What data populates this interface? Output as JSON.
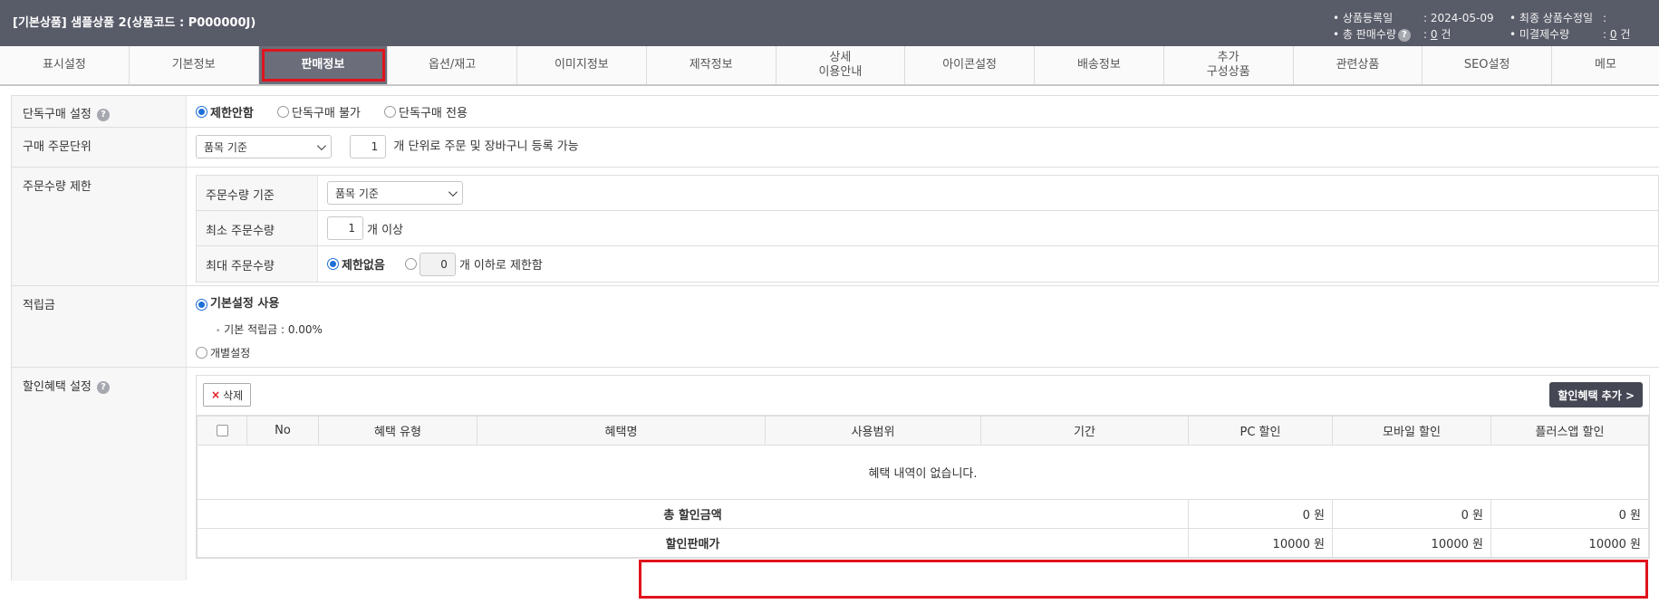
{
  "header": {
    "title": "[기본상품] 샘플상품 2(상품코드 : P000000J)",
    "meta": [
      {
        "label": "상품등록일",
        "value": ": 2024-05-09"
      },
      {
        "label": "총 판매수량",
        "value_prefix": ": ",
        "value_num": "0",
        "value_suffix": " 건",
        "help": "?"
      },
      {
        "label": "최종 상품수정일",
        "value": ":"
      },
      {
        "label": "미결제수량",
        "value_prefix": ": ",
        "value_num": "0",
        "value_suffix": " 건"
      }
    ]
  },
  "tabs": [
    {
      "label": "표시설정"
    },
    {
      "label": "기본정보"
    },
    {
      "label": "판매정보",
      "active": true
    },
    {
      "label": "옵션/재고"
    },
    {
      "label": "이미지정보"
    },
    {
      "label": "제작정보"
    },
    {
      "label": "상세\n이용안내"
    },
    {
      "label": "아이콘설정"
    },
    {
      "label": "배송정보"
    },
    {
      "label": "추가\n구성상품"
    },
    {
      "label": "관련상품"
    },
    {
      "label": "SEO설정"
    },
    {
      "label": "메모"
    }
  ],
  "single_purchase": {
    "label": "단독구매 설정",
    "help": "?",
    "options": [
      "제한안함",
      "단독구매 불가",
      "단독구매 전용"
    ],
    "selected": "제한안함"
  },
  "order_unit": {
    "label": "구매 주문단위",
    "select_value": "품목 기준",
    "qty": "1",
    "suffix": "개 단위로 주문 및 장바구니 등록 가능"
  },
  "order_limit": {
    "label": "주문수량 제한",
    "basis_label": "주문수량 기준",
    "basis_value": "품목 기준",
    "min_label": "최소 주문수량",
    "min_qty": "1",
    "min_suffix": "개 이상",
    "max_label": "최대 주문수량",
    "max_option_unlimited": "제한없음",
    "max_qty": "0",
    "max_suffix": "개 이하로 제한함"
  },
  "points": {
    "label": "적립금",
    "option_default": "기본설정 사용",
    "default_rate_text": "기본 적립금 : 0.00%",
    "option_custom": "개별설정"
  },
  "discount": {
    "label": "할인혜택 설정",
    "help": "?",
    "delete_label": "삭제",
    "add_label": "할인혜택 추가 >",
    "columns": [
      "No",
      "혜택 유형",
      "혜택명",
      "사용범위",
      "기간",
      "PC 할인",
      "모바일 할인",
      "플러스앱 할인"
    ],
    "empty_text": "혜택 내역이 없습니다.",
    "total_label": "총 할인금액",
    "total_values": [
      "0 원",
      "0 원",
      "0 원"
    ],
    "sale_label": "할인판매가",
    "sale_values": [
      "10000 원",
      "10000 원",
      "10000 원"
    ]
  },
  "highlight_color": "#e0141d"
}
